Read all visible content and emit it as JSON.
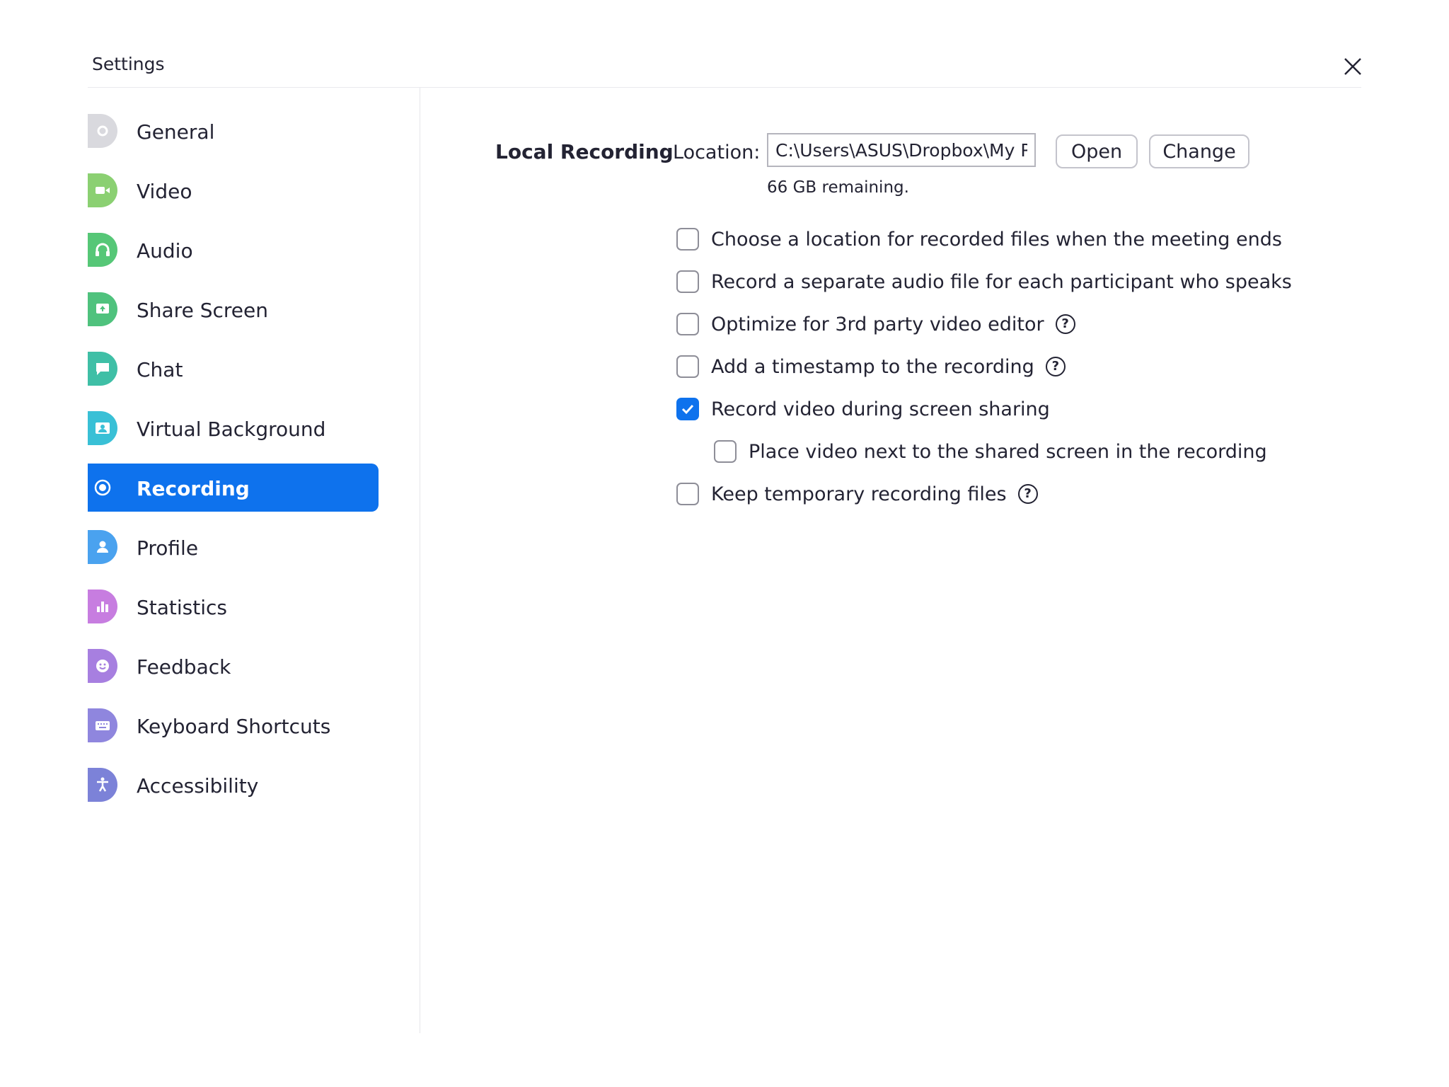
{
  "window": {
    "title": "Settings",
    "close_icon": "close-icon"
  },
  "sidebar": {
    "items": [
      {
        "label": "General",
        "icon": "gear-icon",
        "color": "#d9d9de"
      },
      {
        "label": "Video",
        "icon": "video-camera-icon",
        "color": "#8bd072"
      },
      {
        "label": "Audio",
        "icon": "headphones-icon",
        "color": "#56c777"
      },
      {
        "label": "Share Screen",
        "icon": "share-screen-icon",
        "color": "#4fc27d"
      },
      {
        "label": "Chat",
        "icon": "chat-bubble-icon",
        "color": "#3fbfa6"
      },
      {
        "label": "Virtual Background",
        "icon": "person-background-icon",
        "color": "#39c0d6"
      },
      {
        "label": "Recording",
        "icon": "record-icon",
        "color": "#0e72ed",
        "active": true
      },
      {
        "label": "Profile",
        "icon": "profile-icon",
        "color": "#4aa2ef"
      },
      {
        "label": "Statistics",
        "icon": "bar-chart-icon",
        "color": "#c77de0"
      },
      {
        "label": "Feedback",
        "icon": "smiley-icon",
        "color": "#a77fe0"
      },
      {
        "label": "Keyboard Shortcuts",
        "icon": "keyboard-icon",
        "color": "#8f86de"
      },
      {
        "label": "Accessibility",
        "icon": "accessibility-icon",
        "color": "#7c82d8"
      }
    ]
  },
  "recording": {
    "section_label": "Local Recording",
    "location_label": "Location:",
    "location_value": "C:\\Users\\ASUS\\Dropbox\\My PC",
    "open_label": "Open",
    "change_label": "Change",
    "remaining": "66 GB remaining.",
    "options": [
      {
        "label": "Choose a location for recorded files when the meeting ends",
        "checked": false,
        "help": false,
        "indent": false
      },
      {
        "label": "Record a separate audio file for each participant who speaks",
        "checked": false,
        "help": false,
        "indent": false
      },
      {
        "label": "Optimize for 3rd party video editor",
        "checked": false,
        "help": true,
        "indent": false
      },
      {
        "label": "Add a timestamp to the recording",
        "checked": false,
        "help": true,
        "indent": false
      },
      {
        "label": "Record video during screen sharing",
        "checked": true,
        "help": false,
        "indent": false
      },
      {
        "label": "Place video next to the shared screen in the recording",
        "checked": false,
        "help": false,
        "indent": true
      },
      {
        "label": "Keep temporary recording files",
        "checked": false,
        "help": true,
        "indent": false
      }
    ],
    "help_glyph": "?"
  },
  "colors": {
    "accent": "#0e72ed",
    "text": "#232333",
    "checkbox_border": "#8e8e98"
  }
}
